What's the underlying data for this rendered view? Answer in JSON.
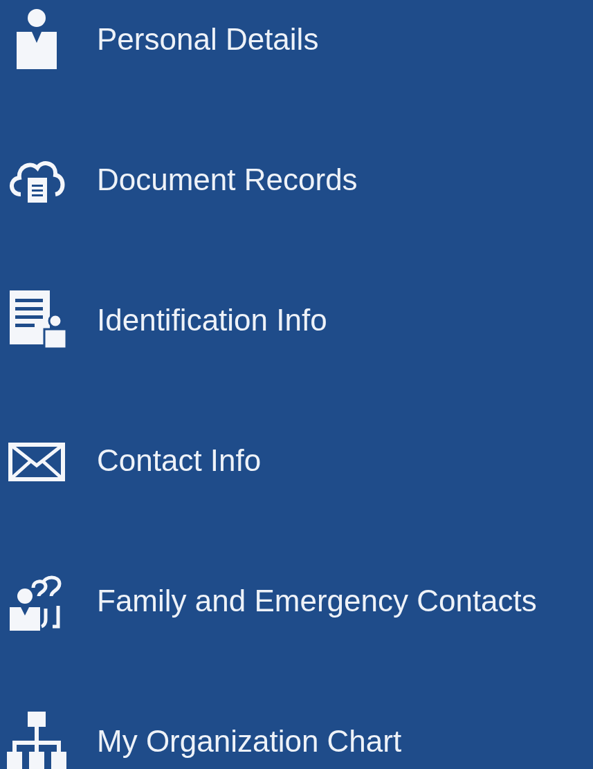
{
  "menu": {
    "items": [
      {
        "label": "Personal Details"
      },
      {
        "label": "Document Records"
      },
      {
        "label": "Identification Info"
      },
      {
        "label": "Contact Info"
      },
      {
        "label": "Family and Emergency Contacts"
      },
      {
        "label": "My Organization Chart"
      }
    ]
  }
}
